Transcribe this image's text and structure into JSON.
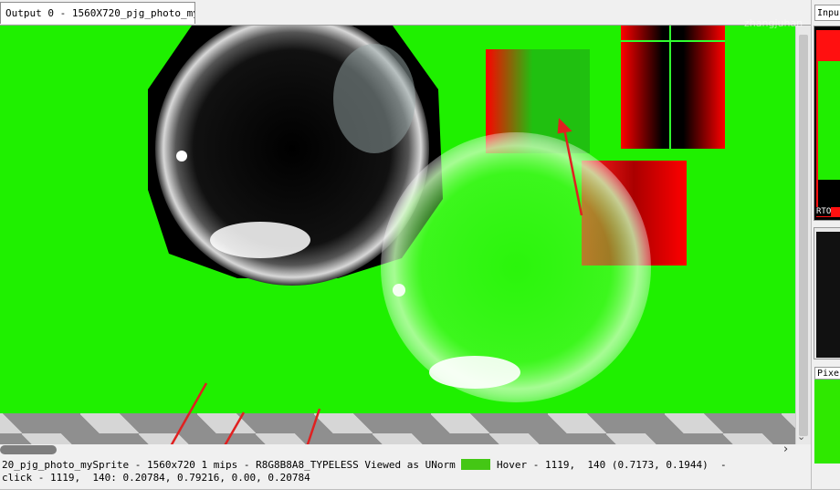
{
  "tab": {
    "title": "Output 0 - 1560X720_pjg_photo_my…"
  },
  "right_panel": {
    "tab_label": "Inpu",
    "rt_label": "RTO",
    "pixel_tab_label": "Pixe"
  },
  "watermark": "zhangjuhan",
  "status": {
    "line1_prefix": "20_pjg_photo_mySprite - ",
    "line1_size": "1560x720",
    "line1_mips": " 1 mips - ",
    "line1_format": "R8G8B8A8_TYPELESS",
    "line1_viewed": " Viewed as UNorm ",
    "line1_hover": " Hover - ",
    "line1_hover_coords": "1119,  140 (0.7173, 0.1944)  -",
    "line2": "click - 1119,  140: 0.20784, 0.79216, 0.00, 0.20784"
  },
  "colors": {
    "background": "#1ff000",
    "swatch": "#44c715",
    "annotation": "#e02020"
  },
  "icons": {
    "scroll_right": "chevron-right-icon",
    "scroll_down": "chevron-down-icon"
  }
}
